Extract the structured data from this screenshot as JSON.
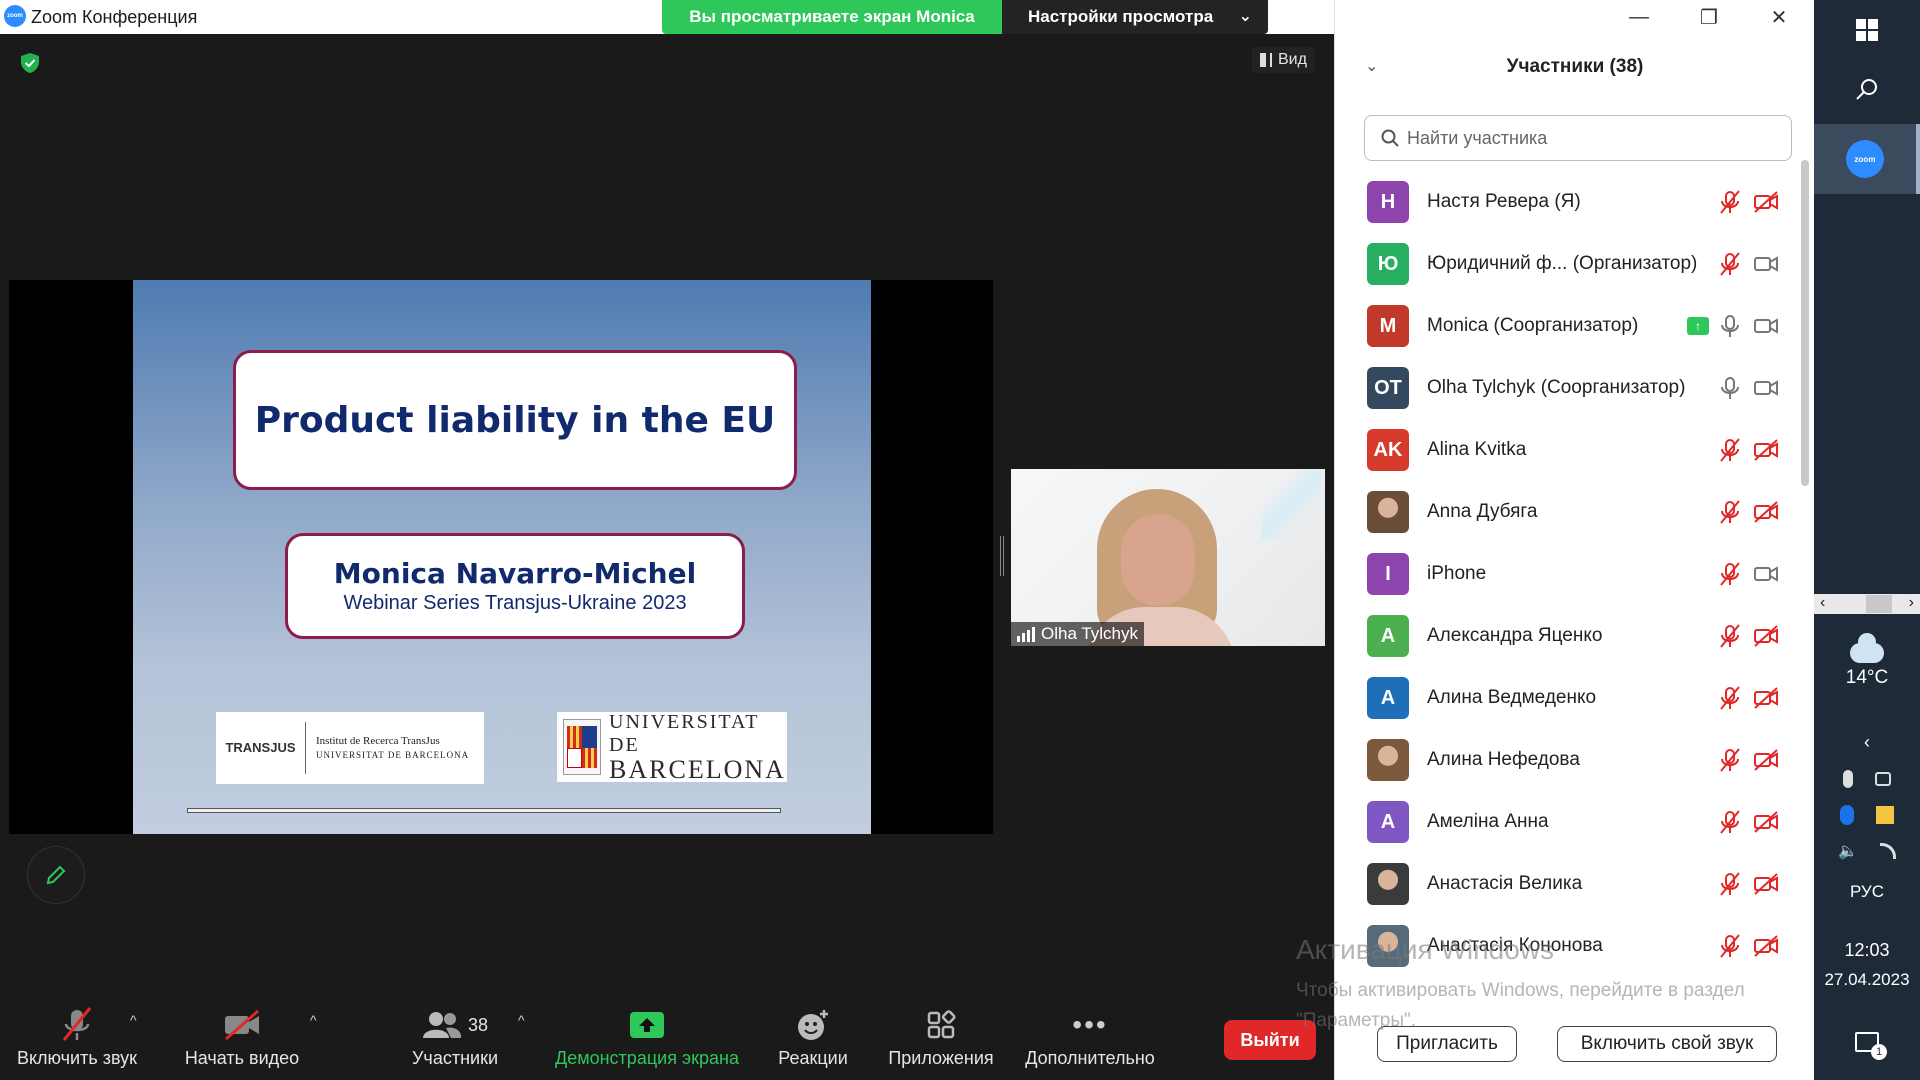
{
  "window": {
    "title": "Zoom Конференция",
    "share_banner": "Вы просматриваете экран Monica",
    "view_options": "Настройки просмотра",
    "view_button": "Вид"
  },
  "slide": {
    "title": "Product liability in the EU",
    "author": "Monica Navarro-Michel",
    "subtitle": "Webinar Series Transjus-Ukraine 2023",
    "logo_left_brand": "TRANSJUS",
    "logo_left_line1": "Institut de Recerca TransJus",
    "logo_left_line2": "UNIVERSITAT DE BARCELONA",
    "logo_right_line1": "UNIVERSITAT DE",
    "logo_right_line2": "BARCELONA"
  },
  "video_tile": {
    "name": "Olha Tylchyk"
  },
  "toolbar": {
    "audio": "Включить звук",
    "video": "Начать видео",
    "participants": "Участники",
    "participants_count": "38",
    "share": "Демонстрация экрана",
    "reactions": "Реакции",
    "apps": "Приложения",
    "more": "Дополнительно",
    "leave": "Выйти"
  },
  "panel": {
    "title": "Участники (38)",
    "search_placeholder": "Найти участника",
    "invite": "Пригласить",
    "unmute_self": "Включить свой звук"
  },
  "participants": [
    {
      "initials": "Н",
      "name": "Настя Ревера (Я)",
      "color": "#8e44ad",
      "mic": "muted",
      "cam": "off"
    },
    {
      "initials": "Ю",
      "name": "Юридичний ф...  (Организатор)",
      "color": "#27ae60",
      "mic": "muted",
      "cam": "on"
    },
    {
      "initials": "M",
      "name": "Monica (Соорганизатор)",
      "color": "#c0392b",
      "mic": "on",
      "cam": "on",
      "sharing": true
    },
    {
      "initials": "OT",
      "name": "Olha Tylchyk (Соорганизатор)",
      "color": "#34495e",
      "mic": "on",
      "cam": "on"
    },
    {
      "initials": "AK",
      "name": "Alina Kvitka",
      "color": "#d63a2a",
      "mic": "muted",
      "cam": "off"
    },
    {
      "initials": "",
      "name": "Anna Дубяга",
      "color": "#6b4e3a",
      "mic": "muted",
      "cam": "off",
      "photo": true
    },
    {
      "initials": "I",
      "name": "iPhone",
      "color": "#8e44ad",
      "mic": "muted",
      "cam": "on"
    },
    {
      "initials": "А",
      "name": "Александра Яценко",
      "color": "#4caf50",
      "mic": "muted",
      "cam": "off"
    },
    {
      "initials": "А",
      "name": "Алина Ведмеденко",
      "color": "#1e6fb8",
      "mic": "muted",
      "cam": "off"
    },
    {
      "initials": "",
      "name": "Алина Нефедова",
      "color": "#7a5a3a",
      "mic": "muted",
      "cam": "off",
      "photo": true
    },
    {
      "initials": "А",
      "name": "Амеліна Анна",
      "color": "#7e57c2",
      "mic": "muted",
      "cam": "off"
    },
    {
      "initials": "",
      "name": "Анастасія Велика",
      "color": "#3b3b3b",
      "mic": "muted",
      "cam": "off",
      "photo": true
    },
    {
      "initials": "",
      "name": "Анастасія Кононова",
      "color": "#556b7a",
      "mic": "muted",
      "cam": "off",
      "photo": true
    }
  ],
  "activation": {
    "line1": "Активация Windows",
    "line2": "Чтобы активировать Windows, перейдите в раздел \"Параметры\"."
  },
  "taskbar": {
    "weather": "14°C",
    "lang": "РУС",
    "time": "12:03",
    "date": "27.04.2023",
    "notif_count": "1"
  },
  "colors": {
    "share_green": "#2ec75a",
    "leave_red": "#e02828",
    "zoom_blue": "#2d8cff",
    "slide_border": "#8c1c4e",
    "slide_text": "#102a6d"
  }
}
